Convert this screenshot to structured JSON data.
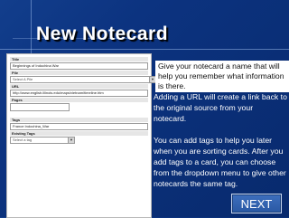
{
  "slide": {
    "title": "New Notecard",
    "caption_name": "Give your notecard a name that will help you remember what information is there.",
    "caption_url": "Adding a URL will create a link back to the original source from your notecard.",
    "caption_tags": "You can add tags to help you later when you are sorting cards.  After you add tags to a card, you can choose from the dropdown menu to give other notecards the same tag.",
    "next_label": "NEXT"
  },
  "form": {
    "title_label": "Title",
    "title_value": "Beginnings of Indochina War",
    "pile_label": "Pile",
    "pile_value": "Select A Pile",
    "url_label": "URL",
    "url_value": "http://www.english.illinois.edu/maps/vietnam/timeline.htm",
    "pages_label": "Pages",
    "tags_label": "Tags",
    "tags_value": "France Indochina_War",
    "existing_tags_label": "Existing Tags",
    "existing_tags_value": "Select a tag"
  },
  "colors": {
    "background": "#0c3380",
    "title_text": "#ffffff",
    "button": "#2f5fae"
  }
}
